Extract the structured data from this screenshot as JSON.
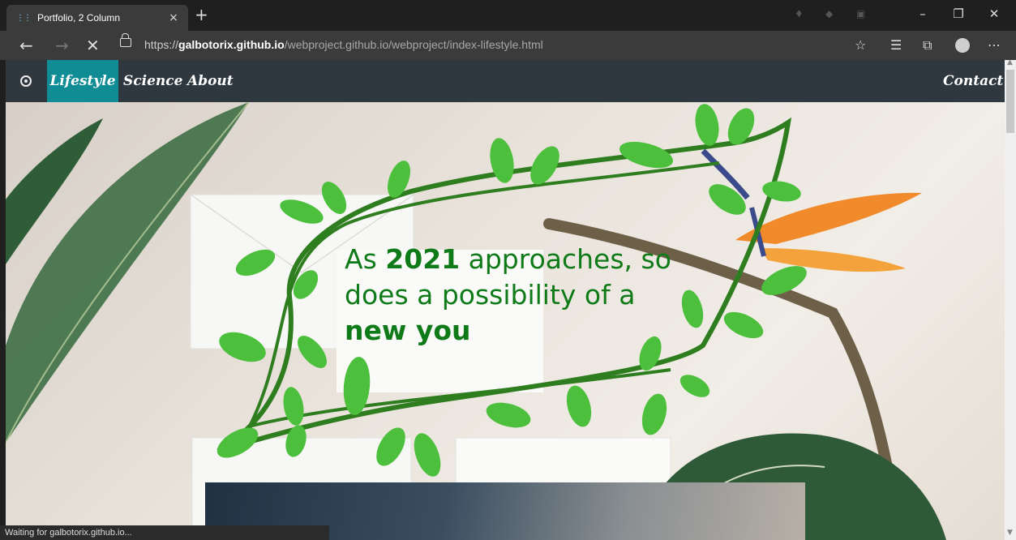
{
  "browser": {
    "tab_title": "Portfolio, 2 Column",
    "tab_close": "×",
    "new_tab": "+",
    "url_protocol": "https://",
    "url_host": "galbotorix.github.io",
    "url_path": "/webproject.github.io/webproject/index-lifestyle.html",
    "status_text": "Waiting for galbotorix.github.io...",
    "icons": [
      "back-icon",
      "forward-icon",
      "stop-icon",
      "lock-icon",
      "favorite-star-icon",
      "favorites-list-icon",
      "collections-icon",
      "profile-icon",
      "more-icon"
    ]
  },
  "nav": {
    "items": [
      {
        "label": "Lifestyle",
        "active": true
      },
      {
        "label": "Science",
        "active": false
      },
      {
        "label": "About",
        "active": false
      }
    ],
    "contact_label": "Contact",
    "active_color": "#0f8c94",
    "bar_color": "#2f383f"
  },
  "hero": {
    "headline_prefix": "As ",
    "headline_year": "2021",
    "headline_middle": " approaches, so does a possibility of a ",
    "headline_emphasis": "new you",
    "text_color": "#0f7a18",
    "vine_color": "#2e7d1f",
    "leaf_color": "#4cbf3c"
  }
}
